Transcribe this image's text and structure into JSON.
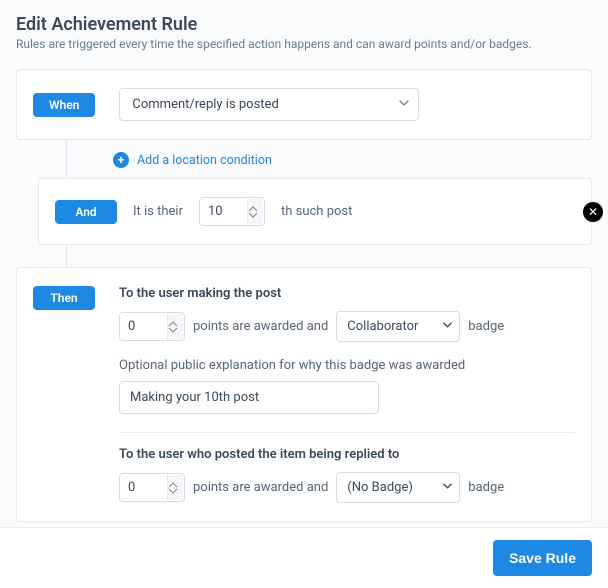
{
  "header": {
    "title": "Edit Achievement Rule",
    "subtitle": "Rules are triggered every time the specified action happens and can award points and/or badges."
  },
  "when": {
    "pill": "When",
    "selected_action": "Comment/reply is posted"
  },
  "add_condition": {
    "label": "Add a location condition"
  },
  "and": {
    "pill": "And",
    "prefix": "It is their",
    "count": "10",
    "suffix": "th such post"
  },
  "then": {
    "pill": "Then",
    "maker": {
      "heading": "To the user making the post",
      "points": "0",
      "points_suffix": "points are awarded and",
      "badge": "Collaborator",
      "badge_suffix": "badge",
      "optional_label": "Optional public explanation for why this badge was awarded",
      "explanation": "Making your 10th post"
    },
    "replied": {
      "heading": "To the user who posted the item being replied to",
      "points": "0",
      "points_suffix": "points are awarded and",
      "badge": "(No Badge)",
      "badge_suffix": "badge"
    }
  },
  "footer": {
    "save": "Save Rule"
  }
}
